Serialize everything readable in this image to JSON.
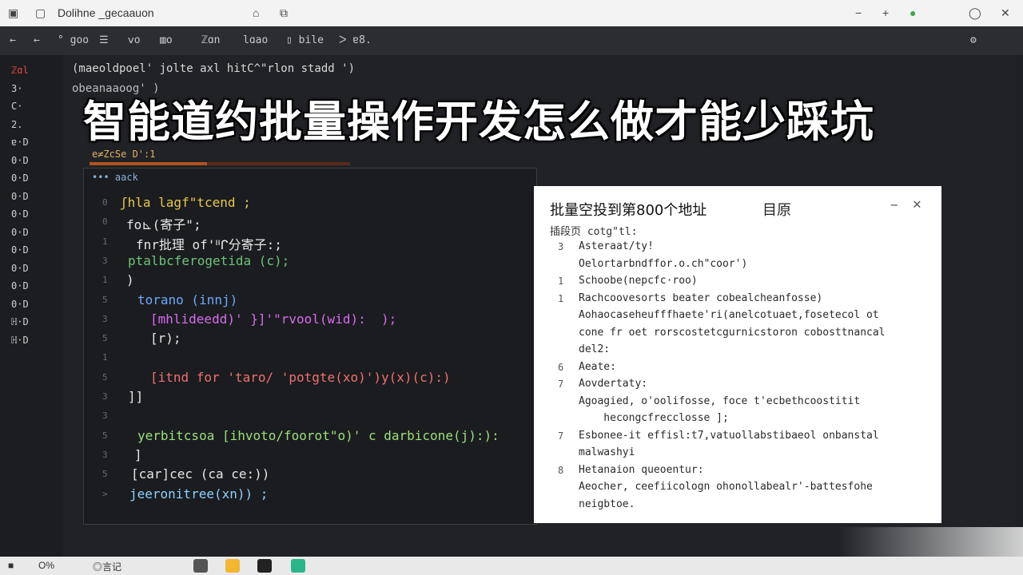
{
  "window": {
    "title": "Dolihne _gecaauon",
    "controls": [
      "−",
      "+",
      "●",
      "◯",
      "✕"
    ]
  },
  "toolbar": {
    "items": [
      "° goo",
      "☰",
      "ⅴo",
      "▥o",
      "ℤɑn",
      "lɑao",
      "▯ bile",
      "ᐳ ɐ8."
    ]
  },
  "line_rail": [
    "ℤɑl",
    "3·",
    "C·",
    "2.",
    "ɐ·D",
    "0·D",
    "0·D",
    "0·D",
    "0·D",
    "0·D",
    "0·D",
    "0·D",
    "0·D",
    "0·D",
    "ℍ·D",
    "ℍ·D"
  ],
  "editor": {
    "path_line": "(maeoldpoel' jolte axl hitC^\"rlon stadd ')",
    "path_line2": "obeanaaoog' )",
    "headline": "智能道约批量操作开发怎么做才能少踩坑",
    "sub_label": "e≠ZcSe D':1",
    "progress": 0.45,
    "code_header": "••• aack"
  },
  "code_lines": [
    {
      "ln": "0",
      "text": "ʃhla lagf\"tcend ;",
      "color": "#e7c84a"
    },
    {
      "ln": "0",
      "text": "fo⊾(寄子\";",
      "color": "#e6e6e6"
    },
    {
      "ln": "1",
      "text": "fnr批理 of'ᐦᒋ分寄子:;",
      "color": "#e6e6e6"
    },
    {
      "ln": "3",
      "text": "ptalbcferogetida (c);",
      "color": "#6cc37a"
    },
    {
      "ln": "1",
      "text": ")",
      "color": "#e6e6e6"
    },
    {
      "ln": "5",
      "text": "torano (innj)",
      "color": "#6fa8ff"
    },
    {
      "ln": "3",
      "text": "[mhlideedd)' }]'\"rvool(wid):  );",
      "color": "#d86cf0"
    },
    {
      "ln": "5",
      "text": "[r);",
      "color": "#e6e6e6"
    },
    {
      "ln": "1",
      "text": "",
      "color": "#e6e6e6"
    },
    {
      "ln": "5",
      "text": "[itnd for 'taro/ 'potgte(xo)')y(x)(c):)",
      "color": "#f07070"
    },
    {
      "ln": "3",
      "text": "]]",
      "color": "#e6e6e6"
    },
    {
      "ln": "3",
      "text": "",
      "color": "#e6e6e6"
    },
    {
      "ln": "5",
      "text": "yerbitcsoa [ihvoto/foorot\"o)' c darbicone(j):):",
      "color": "#9be07a"
    },
    {
      "ln": "3",
      "text": "]",
      "color": "#e6e6e6"
    },
    {
      "ln": "5",
      "text": "[car]cec (ca ce:))",
      "color": "#e6e6e6"
    },
    {
      "ln": ">",
      "text": "jeeronitree(xn)) ;",
      "color": "#8fd0ff"
    }
  ],
  "dialog": {
    "title": "批量空投到第800个地址",
    "tab": "目原",
    "minimize": "−",
    "close": "✕",
    "label": "插段页 cotg\"tl:",
    "lines": [
      {
        "num": "3",
        "text": "Asteraat/ty!",
        "cls": "red"
      },
      {
        "num": "",
        "text": "Oelortarbndffor.o.ch\"coor')",
        "cls": ""
      },
      {
        "num": "1",
        "text": "Schoobe(nepcfc·roo)",
        "cls": ""
      },
      {
        "num": "1",
        "text": "Rachcoovesorts beater cobealcheanfosse)",
        "cls": ""
      },
      {
        "num": "",
        "text": "Aohaocaseheufffhaete'ri(anelcotuaet,fosetecol ot",
        "cls": ""
      },
      {
        "num": "",
        "text": "cone fr oet rorscostetcgurnicstoron cobosttnancal",
        "cls": ""
      },
      {
        "num": "",
        "text": "del2:",
        "cls": ""
      },
      {
        "num": "6",
        "text": "Aeate:",
        "cls": ""
      },
      {
        "num": "7",
        "text": "Aovdertaty:",
        "cls": "blue"
      },
      {
        "num": "",
        "text": "Agoagied, o'oolifosse, foce t'ecbethcoostitit",
        "cls": ""
      },
      {
        "num": "",
        "text": "    hecongcfrecclosse ];",
        "cls": "green"
      },
      {
        "num": "7",
        "text": "Esbonee-it effisl:t7,vatuollabstibaeol onbanstal",
        "cls": ""
      },
      {
        "num": "",
        "text": "malwashyi",
        "cls": ""
      },
      {
        "num": "8",
        "text": "Hetanaion queoentur:",
        "cls": ""
      },
      {
        "num": "",
        "text": "Aeocher, ceefiicologn ohonollabealr'-battesfohe",
        "cls": ""
      },
      {
        "num": "",
        "text": "neigbtoe.",
        "cls": ""
      }
    ]
  },
  "taskbar": {
    "items": [
      "■",
      "O%",
      "◎言记"
    ]
  },
  "colors": {
    "accent_red": "#e24a4a",
    "progress": "#b0531e",
    "dialog_bg": "#ffffff"
  }
}
